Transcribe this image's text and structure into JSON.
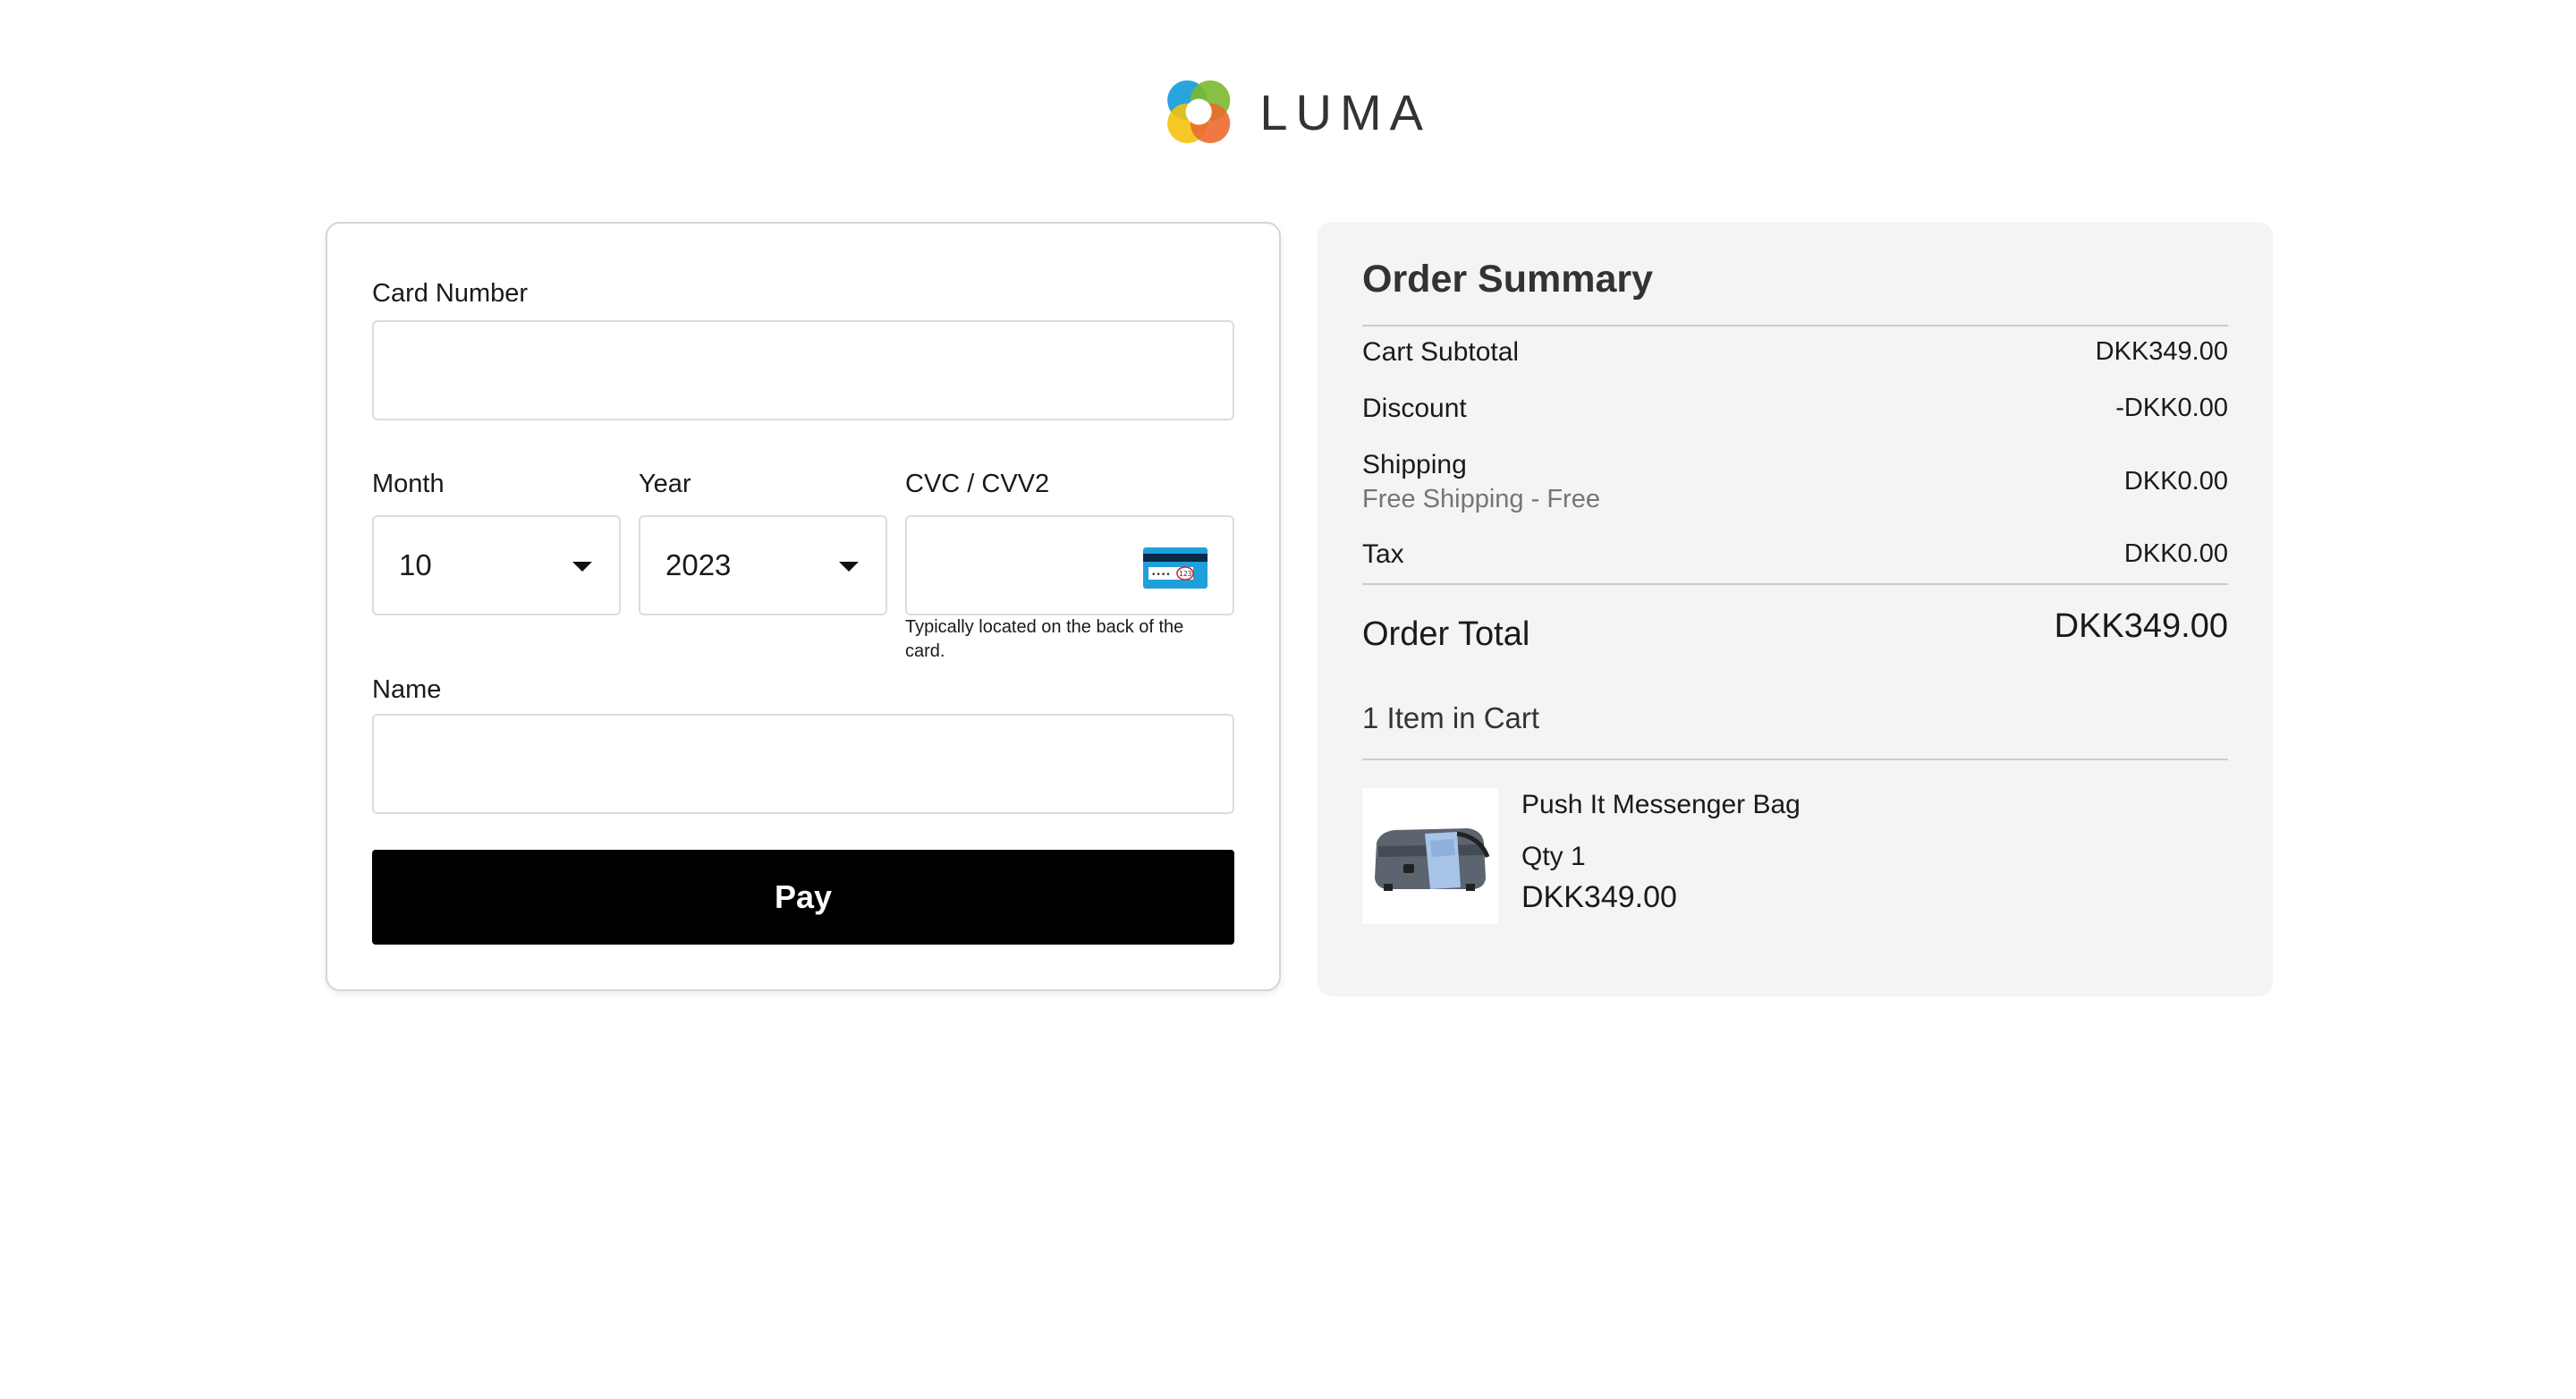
{
  "logo": {
    "text": "LUMA",
    "icon": "luma-logo-icon"
  },
  "payment_form": {
    "card_number": {
      "label": "Card Number",
      "value": "",
      "placeholder": ""
    },
    "month": {
      "label": "Month",
      "value": "10"
    },
    "year": {
      "label": "Year",
      "value": "2023"
    },
    "cvc": {
      "label": "CVC / CVV2",
      "value": "",
      "hint": "Typically located on the back of the card.",
      "icon": "card-back-cvv-icon"
    },
    "name": {
      "label": "Name",
      "value": "",
      "placeholder": ""
    },
    "pay_button_label": "Pay"
  },
  "order_summary": {
    "title": "Order Summary",
    "rows": {
      "subtotal": {
        "label": "Cart Subtotal",
        "value": "DKK349.00"
      },
      "discount": {
        "label": "Discount",
        "value": "-DKK0.00"
      },
      "shipping": {
        "label": "Shipping",
        "sublabel": "Free Shipping - Free",
        "value": "DKK0.00"
      },
      "tax": {
        "label": "Tax",
        "value": "DKK0.00"
      }
    },
    "total": {
      "label": "Order Total",
      "value": "DKK349.00"
    },
    "cart_count": "1 Item in Cart",
    "items": [
      {
        "name": "Push It Messenger Bag",
        "qty": "Qty 1",
        "price": "DKK349.00",
        "image": "messenger-bag-image"
      }
    ]
  },
  "colors": {
    "pay_button": "#000000",
    "summary_bg": "#f4f4f4",
    "logo_blue": "#1979c3",
    "logo_green": "#7ab92d",
    "logo_yellow": "#f4c20d",
    "logo_orange": "#ec6a2e"
  }
}
